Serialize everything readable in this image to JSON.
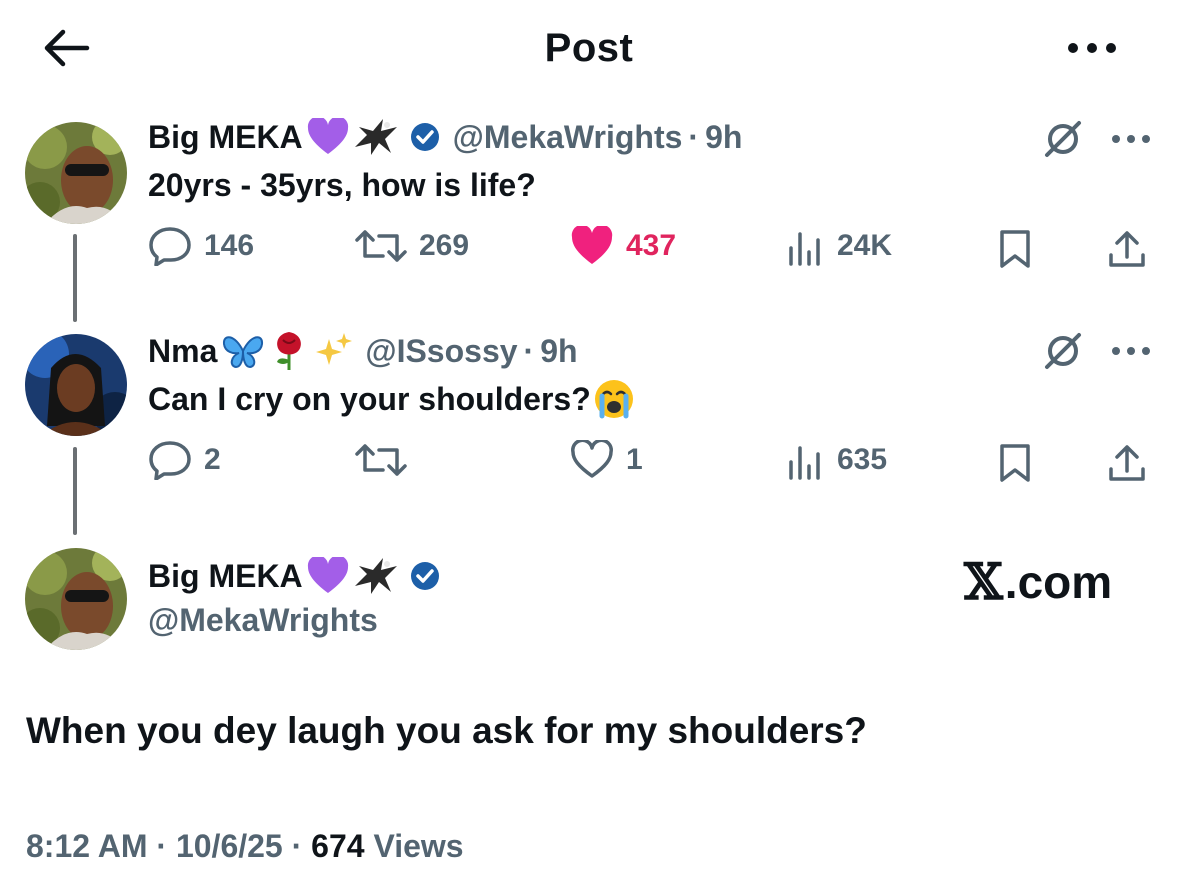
{
  "header": {
    "title": "Post",
    "back_icon": "arrow-left-icon",
    "more_icon": "more-horizontal-icon"
  },
  "colors": {
    "text_primary": "#0f1419",
    "text_secondary": "#536471",
    "like_pink": "#e0245e",
    "verified_blue": "#1d5fa8",
    "thread_line": "#6b6f73"
  },
  "tweets": [
    {
      "name": "Big MEKA",
      "name_emojis": [
        "purple-heart-icon",
        "eagle-icon"
      ],
      "verified": true,
      "handle": "@MekaWrights",
      "separator": "·",
      "time": "9h",
      "text": "20yrs - 35yrs, how is life?",
      "replies": "146",
      "reposts": "269",
      "likes": "437",
      "liked": true,
      "views": "24K"
    },
    {
      "name": "Nma",
      "name_emojis": [
        "butterfly-icon",
        "rose-icon",
        "sparkles-icon"
      ],
      "verified": false,
      "handle": "@ISsossy",
      "separator": "·",
      "time": "9h",
      "text": "Can I cry on your shoulders?",
      "text_emoji": "loudly-crying-face-icon",
      "replies": "2",
      "reposts": "",
      "likes": "1",
      "liked": false,
      "views": "635"
    }
  ],
  "main_post": {
    "name": "Big MEKA",
    "name_emojis": [
      "purple-heart-icon",
      "eagle-icon"
    ],
    "verified": true,
    "handle": "@MekaWrights",
    "watermark": ".com",
    "watermark_icon": "x-logo-icon",
    "text": "When you dey laugh you ask for my shoulders?",
    "time": "8:12 AM",
    "date": "10/6/25",
    "separator": "·",
    "views_count": "674",
    "views_label": "Views"
  }
}
